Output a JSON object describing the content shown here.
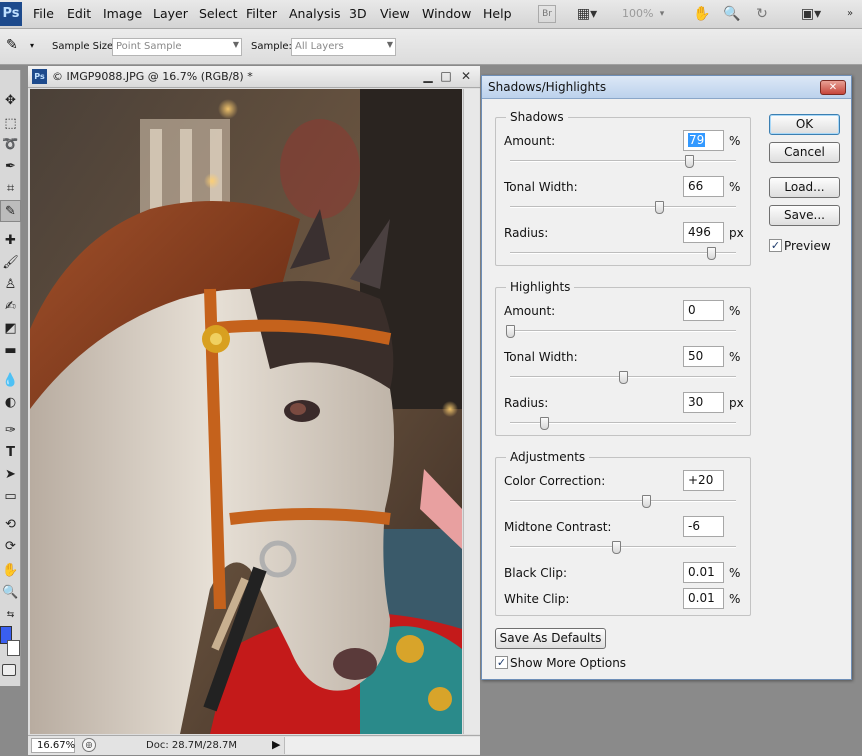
{
  "menubar": {
    "logo": "Ps",
    "items": [
      "File",
      "Edit",
      "Image",
      "Layer",
      "Select",
      "Filter",
      "Analysis",
      "3D",
      "View",
      "Window",
      "Help"
    ],
    "zoom": "100%",
    "icons": [
      "bridge-icon",
      "screen-mode-icon",
      "hand-icon",
      "zoom-icon",
      "rotate-icon",
      "arrange-icon"
    ]
  },
  "options": {
    "sample_size_label": "Sample Size:",
    "sample_size_value": "Point Sample",
    "sample_label": "Sample:",
    "sample_value": "All Layers"
  },
  "tools": {
    "foreground_color": "#3a5ff0",
    "background_color": "#ffffff"
  },
  "document": {
    "title": "© IMGP9088.JPG @ 16.7% (RGB/8) *",
    "zoom": "16.67%",
    "doc_info": "Doc: 28.7M/28.7M"
  },
  "dialog": {
    "title": "Shadows/Highlights",
    "shadows": {
      "title": "Shadows",
      "amount_label": "Amount:",
      "amount": "79",
      "amount_unit": "%",
      "amount_fraction": 0.79,
      "tonal_label": "Tonal Width:",
      "tonal": "66",
      "tonal_unit": "%",
      "tonal_fraction": 0.66,
      "radius_label": "Radius:",
      "radius": "496",
      "radius_unit": "px",
      "radius_fraction": 0.89
    },
    "highlights": {
      "title": "Highlights",
      "amount_label": "Amount:",
      "amount": "0",
      "amount_unit": "%",
      "amount_fraction": 0.0,
      "tonal_label": "Tonal Width:",
      "tonal": "50",
      "tonal_unit": "%",
      "tonal_fraction": 0.5,
      "radius_label": "Radius:",
      "radius": "30",
      "radius_unit": "px",
      "radius_fraction": 0.15
    },
    "adjustments": {
      "title": "Adjustments",
      "color_label": "Color Correction:",
      "color": "+20",
      "color_fraction": 0.6,
      "midtone_label": "Midtone Contrast:",
      "midtone": "-6",
      "midtone_fraction": 0.47,
      "black_label": "Black Clip:",
      "black": "0.01",
      "black_unit": "%",
      "white_label": "White Clip:",
      "white": "0.01",
      "white_unit": "%"
    },
    "buttons": {
      "ok": "OK",
      "cancel": "Cancel",
      "load": "Load...",
      "save": "Save...",
      "save_defaults": "Save As Defaults"
    },
    "preview_label": "Preview",
    "preview_checked": true,
    "more_options_label": "Show More Options",
    "more_options_checked": true
  }
}
